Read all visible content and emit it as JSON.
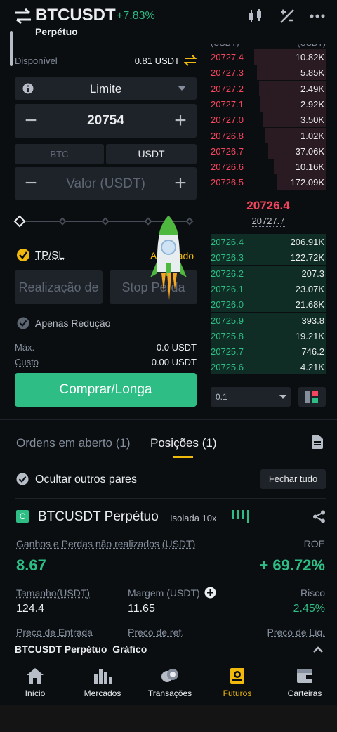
{
  "header": {
    "symbol": "BTCUSDT",
    "change": "+7.83%",
    "subtitle": "Perpétuo"
  },
  "form": {
    "available_label": "Disponível",
    "available_value": "0.81 USDT",
    "order_type": "Limite",
    "price": "20754",
    "unit_tabs": [
      "BTC",
      "USDT"
    ],
    "amount_placeholder": "Valor (USDT)",
    "tpsl_label": "TP/SL",
    "advanced_label": "Avançado",
    "take_profit_placeholder": "Realização de",
    "stop_loss_placeholder": "Stop Perda",
    "reduce_only_label": "Apenas Redução",
    "max_label": "Máx.",
    "max_value": "0.0 USDT",
    "cost_label": "Custo",
    "cost_value": "0.00 USDT",
    "buy_button": "Comprar/Longa",
    "leverage_slider": 0
  },
  "orderbook": {
    "header_price": "(USDT)",
    "header_qty": "(USDT)",
    "asks": [
      {
        "price": "20727.4",
        "qty": "10.82K",
        "depth": 0.62
      },
      {
        "price": "20727.3",
        "qty": "5.85K",
        "depth": 0.6
      },
      {
        "price": "20727.2",
        "qty": "2.49K",
        "depth": 0.58
      },
      {
        "price": "20727.1",
        "qty": "2.92K",
        "depth": 0.57
      },
      {
        "price": "20727.0",
        "qty": "3.50K",
        "depth": 0.55
      },
      {
        "price": "20726.8",
        "qty": "1.02K",
        "depth": 0.53
      },
      {
        "price": "20726.7",
        "qty": "37.06K",
        "depth": 0.5
      },
      {
        "price": "20726.6",
        "qty": "10.16K",
        "depth": 0.45
      },
      {
        "price": "20726.5",
        "qty": "172.09K",
        "depth": 0.42
      }
    ],
    "last_price": "20726.4",
    "mark_price": "20727.7",
    "bids": [
      {
        "price": "20726.4",
        "qty": "206.91K",
        "depth": 1.0
      },
      {
        "price": "20726.3",
        "qty": "122.72K",
        "depth": 1.0
      },
      {
        "price": "20726.2",
        "qty": "207.3",
        "depth": 1.0
      },
      {
        "price": "20726.1",
        "qty": "23.07K",
        "depth": 1.0
      },
      {
        "price": "20726.0",
        "qty": "21.68K",
        "depth": 1.0
      },
      {
        "price": "20725.9",
        "qty": "393.8",
        "depth": 1.0
      },
      {
        "price": "20725.8",
        "qty": "19.21K",
        "depth": 1.0
      },
      {
        "price": "20725.7",
        "qty": "746.2",
        "depth": 1.0
      },
      {
        "price": "20725.6",
        "qty": "4.21K",
        "depth": 1.0
      }
    ],
    "precision": "0.1"
  },
  "tabs": {
    "open_orders": "Ordens em aberto (1)",
    "positions": "Posições (1)"
  },
  "positions": {
    "hide_other_pairs": "Ocultar outros pares",
    "close_all": "Fechar tudo",
    "badge": "C",
    "symbol": "BTCUSDT Perpétuo",
    "margin_mode": "Isolada 10x",
    "pnl_label": "Ganhos e Perdas não realizados (USDT)",
    "roe_label": "ROE",
    "pnl_value": "8.67",
    "roe_value": "+ 69.72%",
    "size_label": "Tamanho(USDT)",
    "size_value": "124.4",
    "margin_label": "Margem (USDT)",
    "margin_value": "11.65",
    "risk_label": "Risco",
    "risk_value": "2.45%",
    "entry_label": "Preço de Entrada",
    "ref_label": "Preço de ref.",
    "liq_label": "Preço de Liq."
  },
  "chart_bar": {
    "symbol": "BTCUSDT Perpétuo",
    "chart_label": "Gráfico"
  },
  "nav": [
    "Início",
    "Mercados",
    "Transações",
    "Futuros",
    "Carteiras"
  ],
  "colors": {
    "background": "#0b0e11",
    "panel": "#1e2329",
    "green": "#2ebd85",
    "red": "#f6465d",
    "accent": "#f0b90b",
    "muted": "#848e9c"
  }
}
